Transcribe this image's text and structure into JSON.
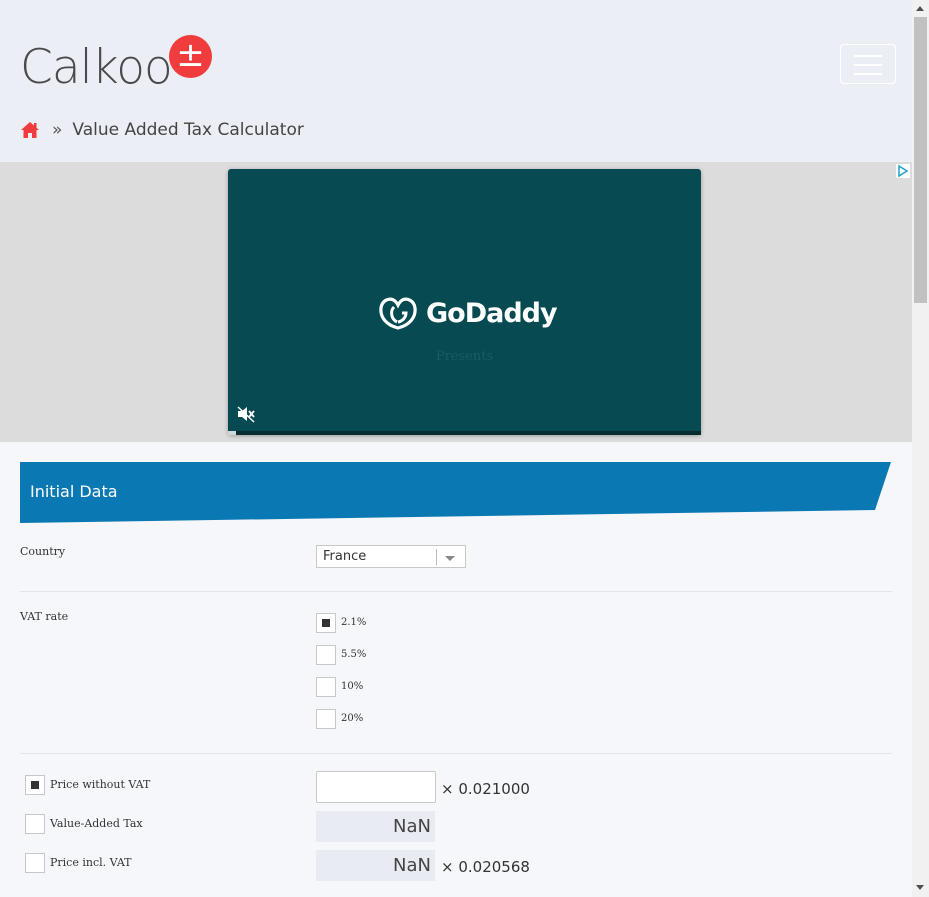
{
  "header": {
    "logo_text": "Calkoo",
    "logo_badge": "±",
    "breadcrumb_sep": "»",
    "breadcrumb_current": "Value Added Tax Calculator"
  },
  "ad": {
    "brand": "GoDaddy",
    "presents": "Presents"
  },
  "panel": {
    "title": "Initial Data"
  },
  "country": {
    "label": "Country",
    "selected": "France"
  },
  "vat_rate": {
    "label": "VAT rate",
    "options": [
      "2.1%",
      "5.5%",
      "10%",
      "20%"
    ],
    "selected": "2.1%"
  },
  "calc": {
    "price_without_vat_label": "Price without VAT",
    "price_without_vat_value": "",
    "price_without_vat_factor": "× 0.021000",
    "vat_label": "Value-Added Tax",
    "vat_value": "NaN",
    "price_incl_vat_label": "Price incl. VAT",
    "price_incl_vat_value": "NaN",
    "price_incl_vat_factor": "× 0.020568",
    "selected": "price_without_vat"
  },
  "colors": {
    "accent_red": "#f03c3c",
    "panel_blue": "#0a78b3",
    "ad_bg": "#074a52"
  }
}
